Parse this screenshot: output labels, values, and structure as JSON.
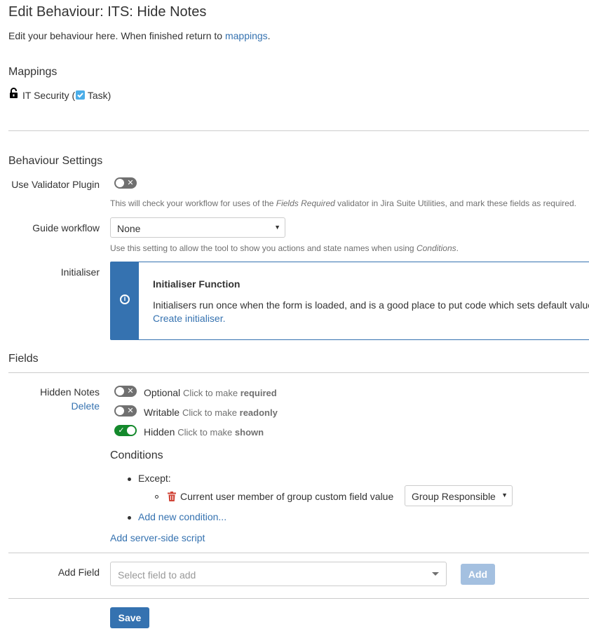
{
  "page": {
    "title": "Edit Behaviour: ITS: Hide Notes",
    "intro_text": "Edit your behaviour here. When finished return to",
    "intro_link": "mappings",
    "intro_suffix": "."
  },
  "mappings": {
    "heading": "Mappings",
    "project": "IT Security",
    "open_paren": "(",
    "issue_type": "Task",
    "close_paren": ")"
  },
  "settings": {
    "heading": "Behaviour Settings",
    "validator_label": "Use Validator Plugin",
    "validator_on": false,
    "validator_desc_pre": "This will check your workflow for uses of the",
    "validator_desc_em": "Fields Required",
    "validator_desc_post": "validator in Jira Suite Utilities, and mark these fields as required.",
    "workflow_label": "Guide workflow",
    "workflow_value": "None",
    "workflow_desc_pre": "Use this setting to allow the tool to show you actions and state names when using",
    "workflow_desc_em": "Conditions",
    "workflow_desc_post": ".",
    "initialiser_label": "Initialiser",
    "initialiser_title": "Initialiser Function",
    "initialiser_text": "Initialisers run once when the form is loaded, and is a good place to put code which sets default value",
    "initialiser_link": "Create initialiser."
  },
  "fields": {
    "heading": "Fields",
    "field_name": "Hidden Notes",
    "delete_label": "Delete",
    "toggles": [
      {
        "state": "Optional",
        "hint": "Click to make",
        "target": "required",
        "on": false
      },
      {
        "state": "Writable",
        "hint": "Click to make",
        "target": "readonly",
        "on": false
      },
      {
        "state": "Hidden",
        "hint": "Click to make",
        "target": "shown",
        "on": true
      }
    ],
    "conditions_heading": "Conditions",
    "except_label": "Except:",
    "condition_text": "Current user member of group custom field value",
    "condition_select": "Group Responsible",
    "add_condition": "Add new condition...",
    "add_script": "Add server-side script"
  },
  "add_field": {
    "label": "Add Field",
    "placeholder": "Select field to add",
    "button": "Add"
  },
  "save_button": "Save",
  "colors": {
    "link": "#3572b0",
    "primary": "#3572b0",
    "toggle_on": "#14892c",
    "toggle_off": "#707070",
    "delete_icon": "#d04437"
  }
}
